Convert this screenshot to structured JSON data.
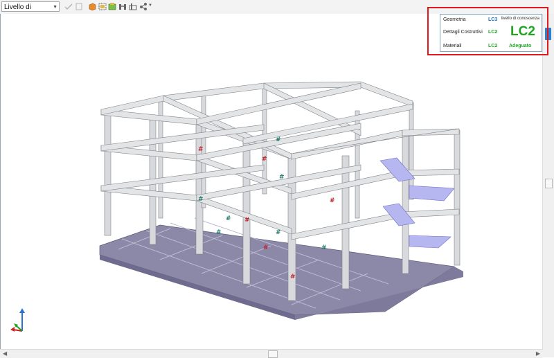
{
  "toolbar": {
    "level_select_value": "Livello di Conoscenza",
    "icons": [
      "check-icon",
      "clipboard-icon",
      "cube-icon",
      "grid-select-icon",
      "structure-icon",
      "binoculars-icon",
      "columns-icon",
      "share-icon"
    ]
  },
  "knowledge_panel": {
    "title": "livello di conoscenza",
    "rows": [
      {
        "label": "Geometria",
        "value": "LC3",
        "color": "#1a6fc4"
      },
      {
        "label": "Dettagli Costruttivi",
        "value": "LC2",
        "color": "#1fa51f"
      },
      {
        "label": "Materiali",
        "value": "LC2",
        "color": "#1fa51f"
      }
    ],
    "overall": "LC2",
    "status": "Adeguato"
  },
  "colors": {
    "highlight_border": "#e0191e",
    "accent_green": "#1fa51f",
    "accent_blue": "#1a6fc4"
  }
}
